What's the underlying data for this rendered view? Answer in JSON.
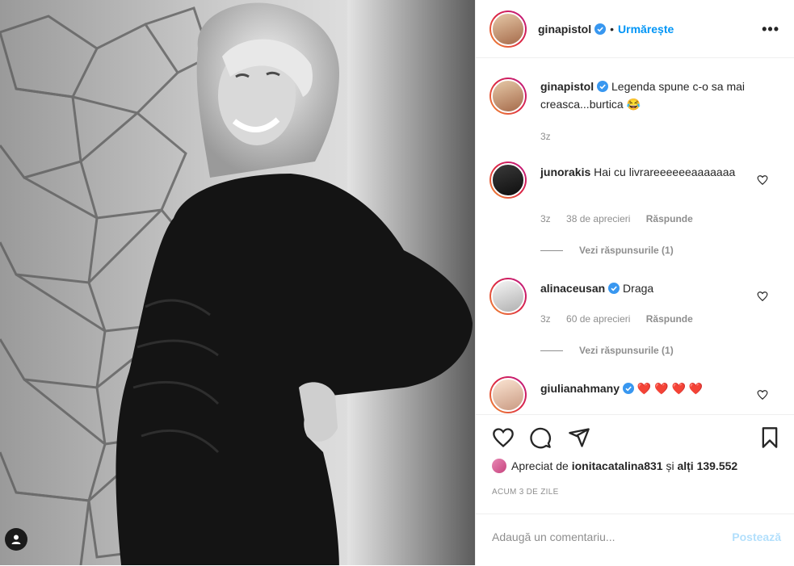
{
  "header": {
    "username": "ginapistol",
    "separator": "•",
    "follow_label": "Urmărește",
    "more_label": "•••"
  },
  "caption": {
    "username": "ginapistol",
    "text": "Legenda spune c-o sa mai creasca...burtica 😂",
    "time": "3z"
  },
  "comments": [
    {
      "username": "junorakis",
      "text": "Hai cu livrareeeeeeaaaaaaa",
      "time": "3z",
      "likes": "38 de aprecieri",
      "reply_label": "Răspunde",
      "view_replies": "Vezi răspunsurile (1)"
    },
    {
      "username": "alinaceusan",
      "text": "Draga",
      "time": "3z",
      "likes": "60 de aprecieri",
      "reply_label": "Răspunde",
      "view_replies": "Vezi răspunsurile (1)"
    },
    {
      "username": "giulianahmany",
      "text": "❤️ ❤️ ❤️ ❤️",
      "time": "",
      "likes": "",
      "reply_label": ""
    }
  ],
  "liked_by": {
    "prefix": "Apreciat de",
    "user": "ionitacatalina831",
    "middle": "și",
    "others": "alți 139.552"
  },
  "timestamp": "ACUM 3 DE ZILE",
  "comment_box": {
    "placeholder": "Adaugă un comentariu...",
    "post_label": "Postează"
  },
  "colors": {
    "accent": "#0095f6",
    "text": "#262626",
    "muted": "#8e8e8e",
    "post_disabled": "#b2dffc",
    "verified": "#3897f0",
    "heart_red": "#e0182d"
  },
  "icons": [
    "verified-icon",
    "heart-icon",
    "comment-icon",
    "share-icon",
    "bookmark-icon",
    "user-tag-icon",
    "more-icon"
  ]
}
